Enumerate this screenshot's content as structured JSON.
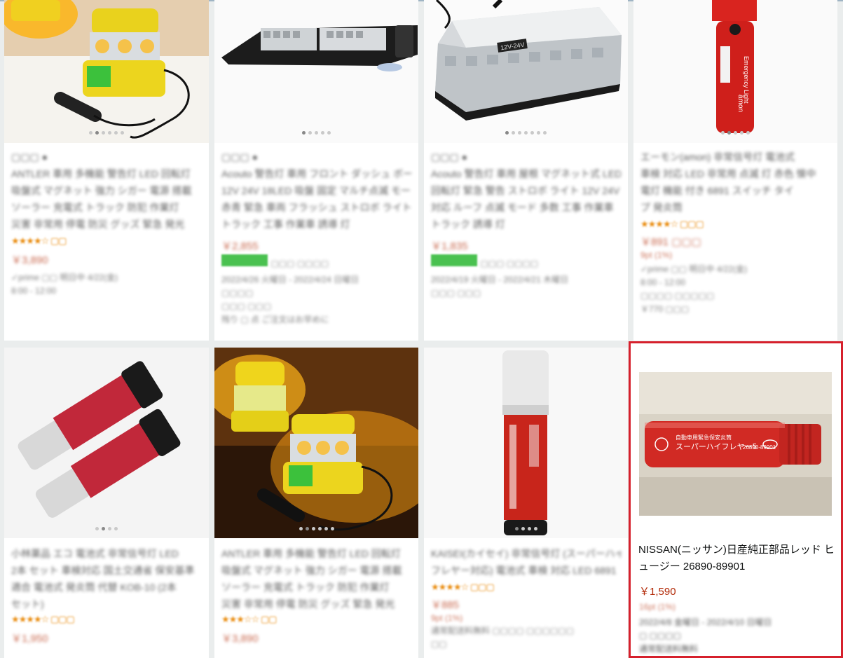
{
  "colors": {
    "accent_border": "#d6202c",
    "price": "#b12704",
    "star": "#e98a0b",
    "prime": "#1399ff"
  },
  "selected_product": {
    "title": "NISSAN(ニッサン)日産純正部品レッド ヒュージー 26890-89901",
    "price": "￥1,590",
    "image_label_main": "スーパーハイフレヤー5",
    "image_label_sub": "自動車用緊急保安炎筒",
    "image_part_no": "26890-89901"
  },
  "image_labels": {
    "product3_badge": "12V-24V",
    "product4_label": "Emergency Light",
    "product4_brand": "amon"
  },
  "icons": [
    "star-icon",
    "prime-icon",
    "carousel-dot-icon"
  ]
}
